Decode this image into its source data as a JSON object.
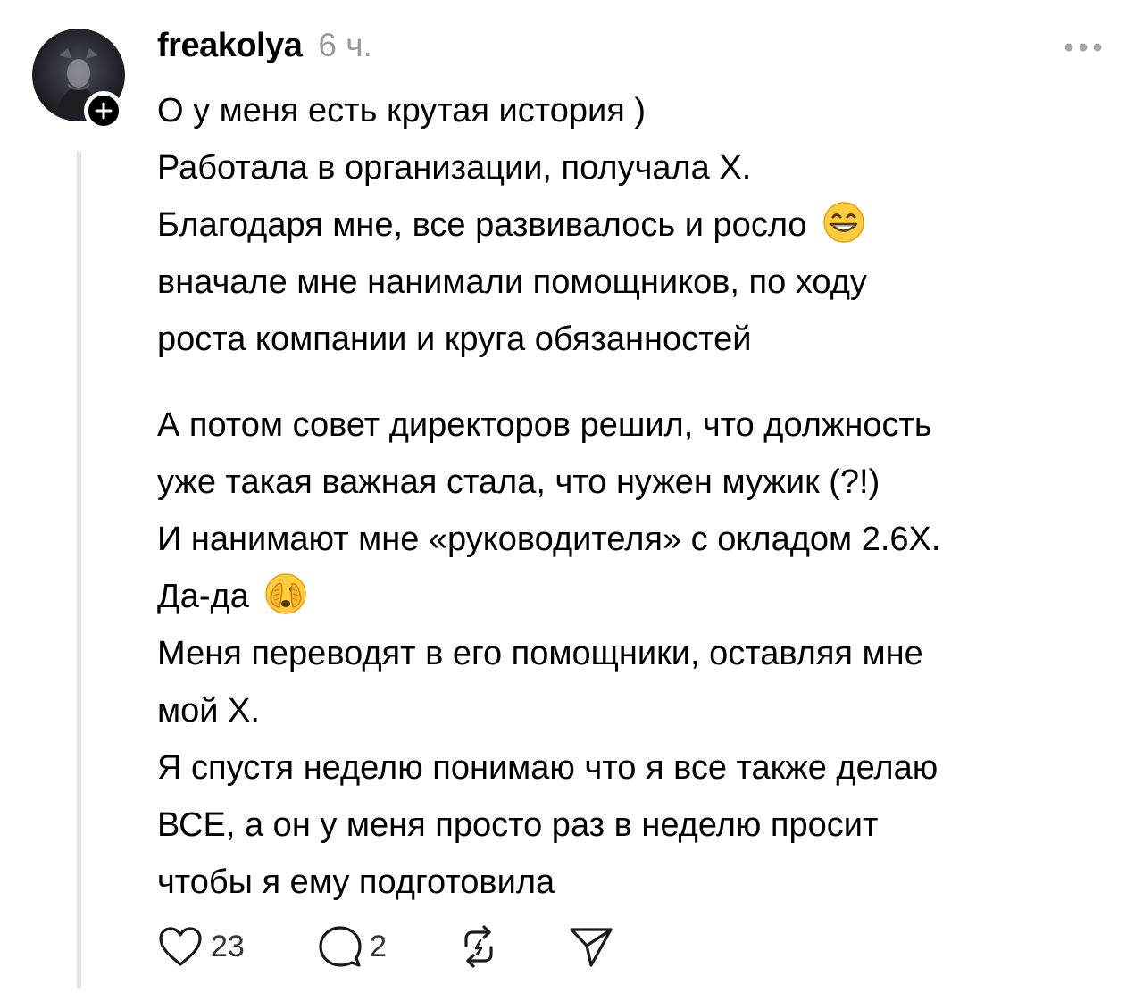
{
  "post": {
    "username": "freakolya",
    "time": "6 ч.",
    "lines": [
      "О у меня есть крутая история )",
      "Работала в организации, получала Х.",
      "Благодаря мне, все развивалось и росло",
      "вначале мне нанимали помощников, по ходу",
      "роста компании и круга обязанностей",
      "А потом совет директоров решил, что должность",
      "уже такая важная стала, что нужен мужик (?!)",
      "И нанимают мне «руководителя» с окладом 2.6Х.",
      "Да-да",
      "Меня переводят в его помощники, оставляя мне",
      "мой Х.",
      "Я спустя неделю понимаю что я все также делаю",
      "ВСЕ, а он у меня просто раз в неделю просит",
      "чтобы я ему подготовила"
    ]
  },
  "actions": {
    "likes": "23",
    "replies": "2"
  },
  "icons": {
    "avatar": "avatar",
    "follow": "plus-icon",
    "more": "more-icon",
    "like": "heart-icon",
    "reply": "comment-icon",
    "repost": "repost-icon",
    "share": "send-icon",
    "emoji_grin": "grinning-emoji-icon",
    "emoji_peek": "face-with-peeking-eye-emoji-icon"
  },
  "colors": {
    "text": "#000000",
    "muted": "#9a9a9a",
    "thread_line": "#e3e3e3"
  }
}
